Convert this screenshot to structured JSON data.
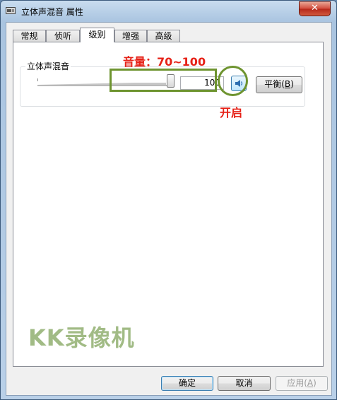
{
  "window": {
    "title": "立体声混音 属性",
    "close_label": "✕"
  },
  "tabs": [
    {
      "label": "常规",
      "active": false
    },
    {
      "label": "侦听",
      "active": false
    },
    {
      "label": "级别",
      "active": true
    },
    {
      "label": "增强",
      "active": false
    },
    {
      "label": "高级",
      "active": false
    }
  ],
  "levels": {
    "group_label": "立体声混音",
    "volume_value": "100",
    "volume_level": 1.0,
    "muted": false,
    "balance_label": "平衡(B)",
    "balance_prefix": "平衡(",
    "balance_key": "B",
    "balance_suffix": ")"
  },
  "annotations": {
    "volume_text": "音量：70~100",
    "open_text": "开启",
    "highlight_color": "#6e9430",
    "text_color": "#e62117"
  },
  "watermark": "KK录像机",
  "buttons": {
    "ok": "确定",
    "cancel": "取消",
    "apply_prefix": "应用(",
    "apply_key": "A",
    "apply_suffix": ")"
  }
}
